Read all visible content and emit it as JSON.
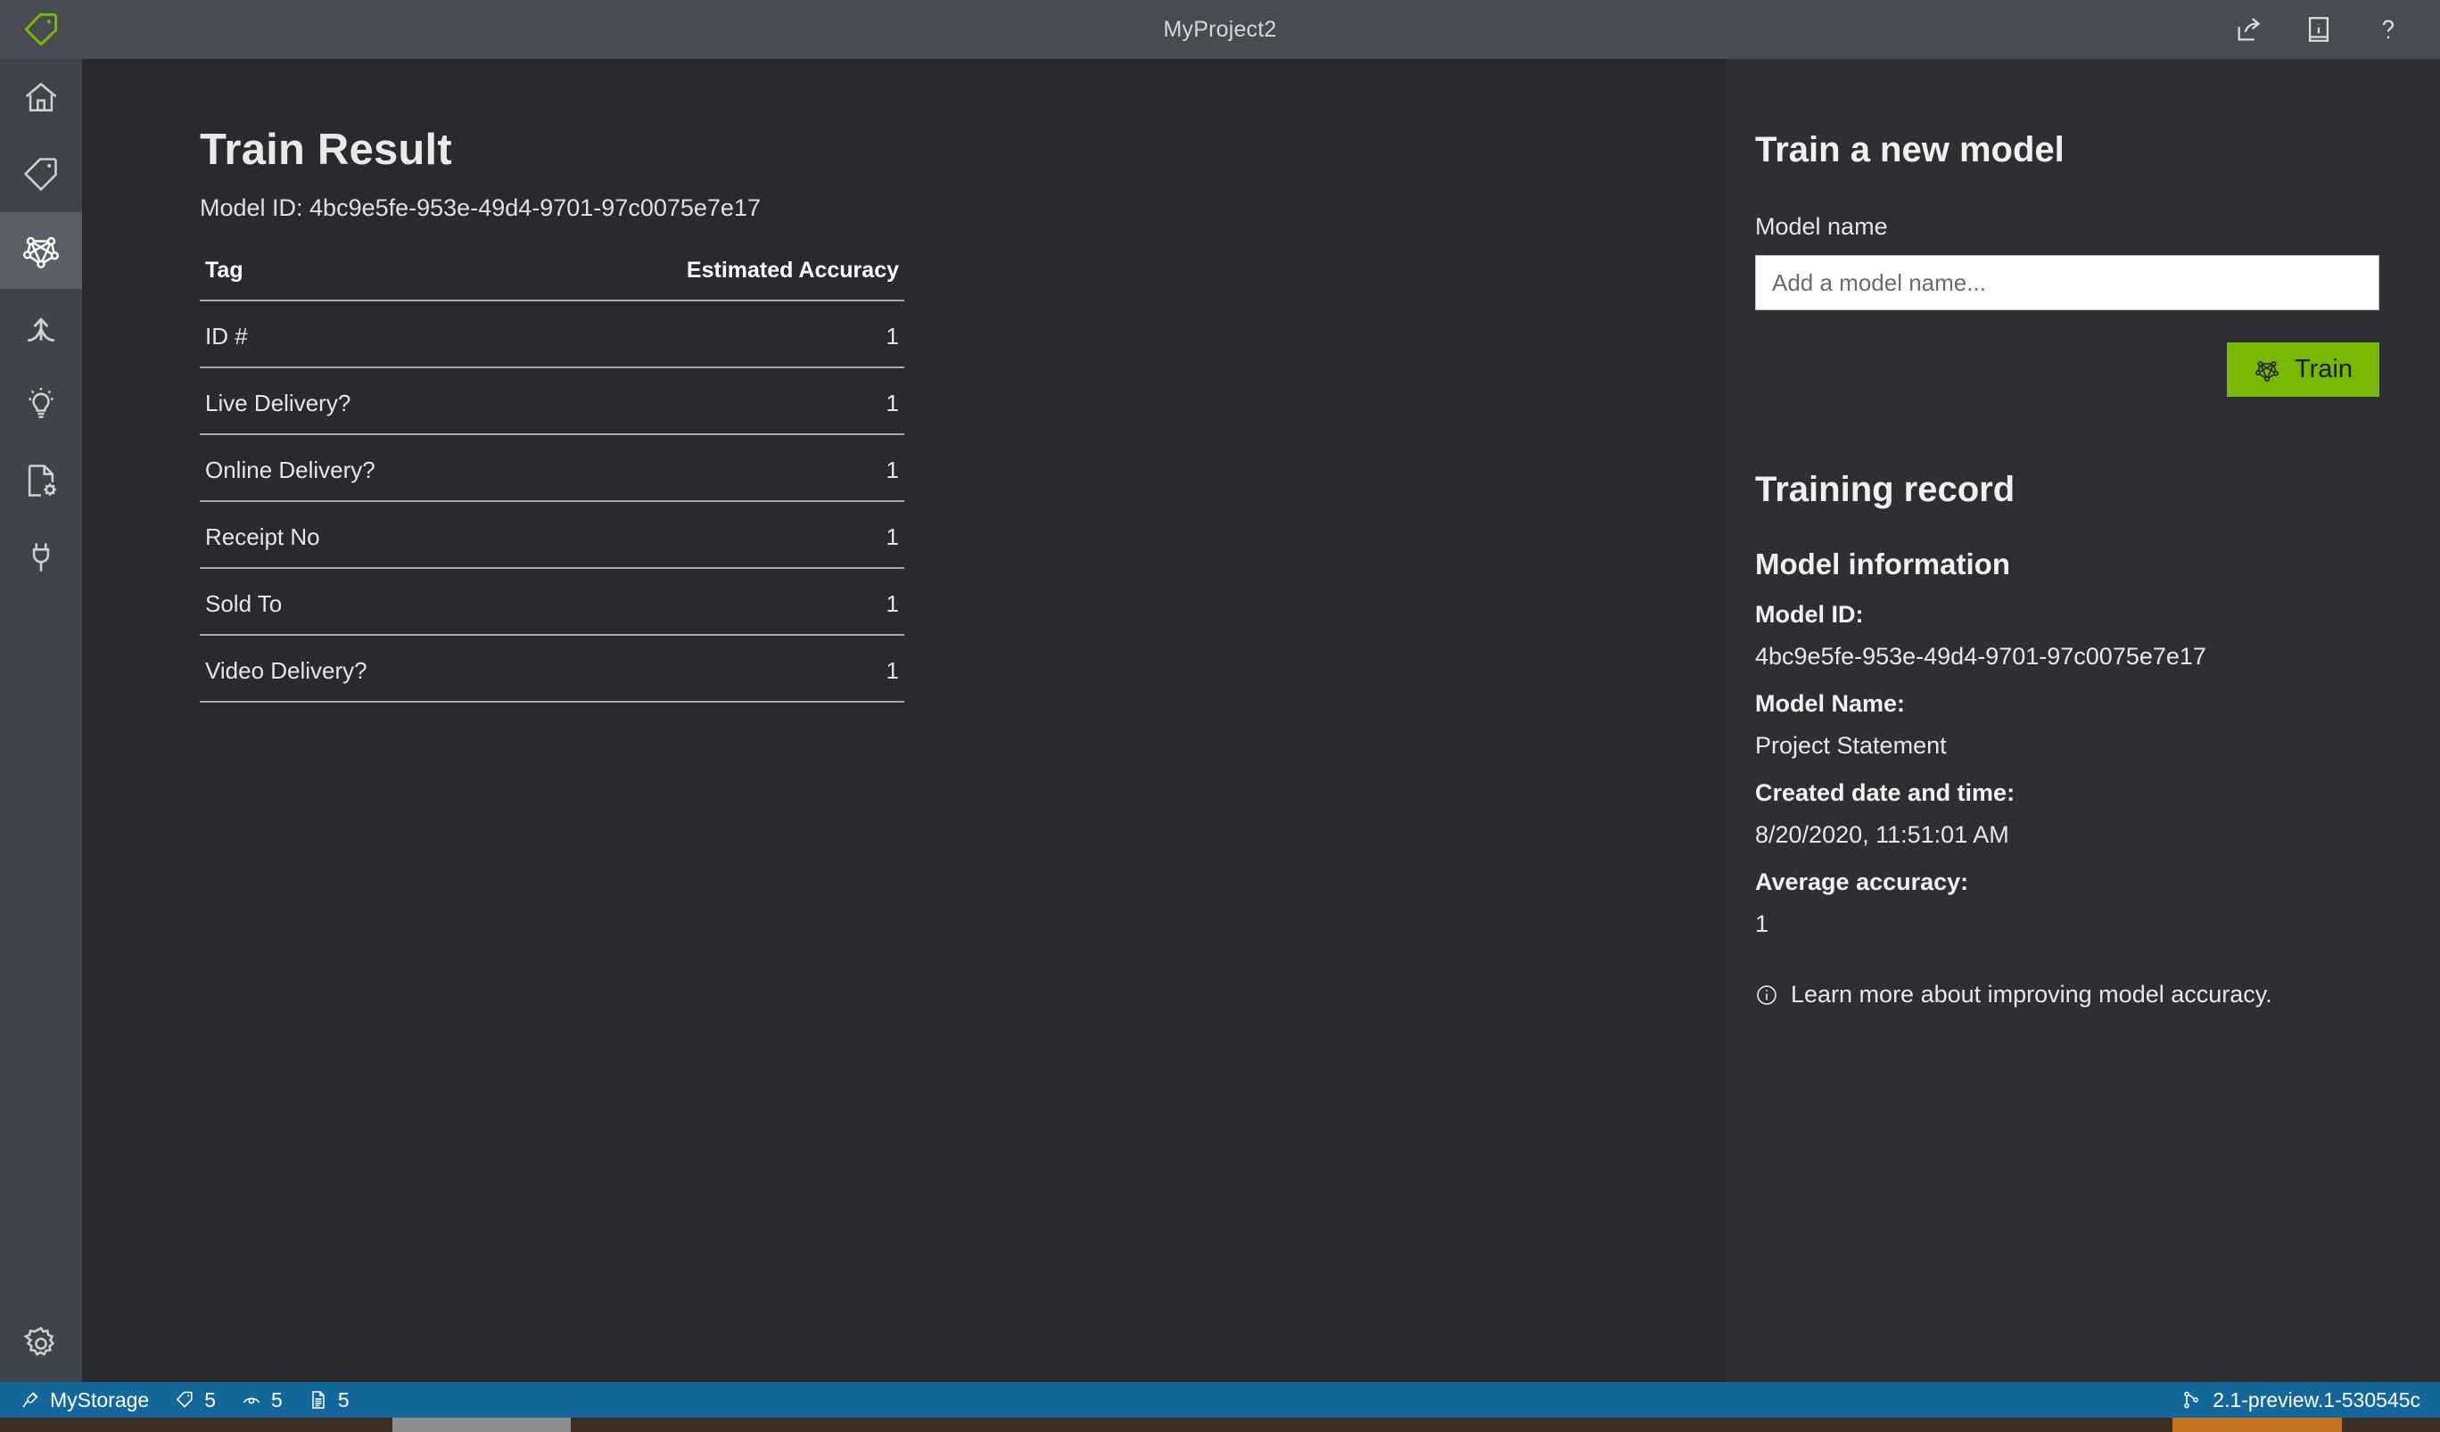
{
  "titlebar": {
    "logo_icon": "tag-logo-icon",
    "title": "MyProject2",
    "actions": [
      {
        "icon": "share-icon",
        "name": "share-button"
      },
      {
        "icon": "info-book-icon",
        "name": "info-button"
      },
      {
        "icon": "help-icon",
        "name": "help-button"
      }
    ]
  },
  "sidebar": {
    "items": [
      {
        "icon": "home-icon",
        "name": "sidebar-item-home",
        "active": false
      },
      {
        "icon": "tag-icon",
        "name": "sidebar-item-tag",
        "active": false
      },
      {
        "icon": "model-network-icon",
        "name": "sidebar-item-train",
        "active": true
      },
      {
        "icon": "merge-arrows-icon",
        "name": "sidebar-item-compose",
        "active": false
      },
      {
        "icon": "lightbulb-icon",
        "name": "sidebar-item-predict",
        "active": false
      },
      {
        "icon": "document-settings-icon",
        "name": "sidebar-item-document-settings",
        "active": false
      },
      {
        "icon": "plug-icon",
        "name": "sidebar-item-connections",
        "active": false
      }
    ],
    "settings": {
      "icon": "gear-icon",
      "name": "sidebar-item-settings"
    }
  },
  "main": {
    "title": "Train Result",
    "model_id_line": "Model ID: 4bc9e5fe-953e-49d4-9701-97c0075e7e17",
    "table": {
      "headers": {
        "tag": "Tag",
        "accuracy": "Estimated Accuracy"
      },
      "rows": [
        {
          "tag": "ID #",
          "accuracy": "1"
        },
        {
          "tag": "Live Delivery?",
          "accuracy": "1"
        },
        {
          "tag": "Online Delivery?",
          "accuracy": "1"
        },
        {
          "tag": "Receipt No",
          "accuracy": "1"
        },
        {
          "tag": "Sold To",
          "accuracy": "1"
        },
        {
          "tag": "Video Delivery?",
          "accuracy": "1"
        }
      ]
    }
  },
  "rightpanel": {
    "train_heading": "Train a new model",
    "model_name_label": "Model name",
    "model_name_value": "",
    "model_name_placeholder": "Add a model name...",
    "train_button": "Train",
    "train_button_icon": "model-network-icon",
    "training_record_heading": "Training record",
    "model_information_heading": "Model information",
    "fields": [
      {
        "key": "Model ID:",
        "value": "4bc9e5fe-953e-49d4-9701-97c0075e7e17"
      },
      {
        "key": "Model Name:",
        "value": "Project Statement"
      },
      {
        "key": "Created date and time:",
        "value": "8/20/2020, 11:51:01 AM"
      },
      {
        "key": "Average accuracy:",
        "value": "1"
      }
    ],
    "learn_more": "Learn more about improving model accuracy.",
    "learn_more_icon": "info-circle-icon"
  },
  "statusbar": {
    "storage_icon": "plug-icon",
    "storage_label": "MyStorage",
    "tag_icon": "tag-icon",
    "tag_count": "5",
    "eye_icon": "eye-icon",
    "eye_count": "5",
    "doc_icon": "document-icon",
    "doc_count": "5",
    "branch_icon": "branch-icon",
    "version": "2.1-preview.1-530545c"
  },
  "colors": {
    "accent_green": "#76b900",
    "status_blue": "#13679a",
    "titlebar": "#484c52",
    "rail": "#3f434a",
    "main_bg": "#282a2e",
    "panel_bg": "#2d2f33"
  }
}
